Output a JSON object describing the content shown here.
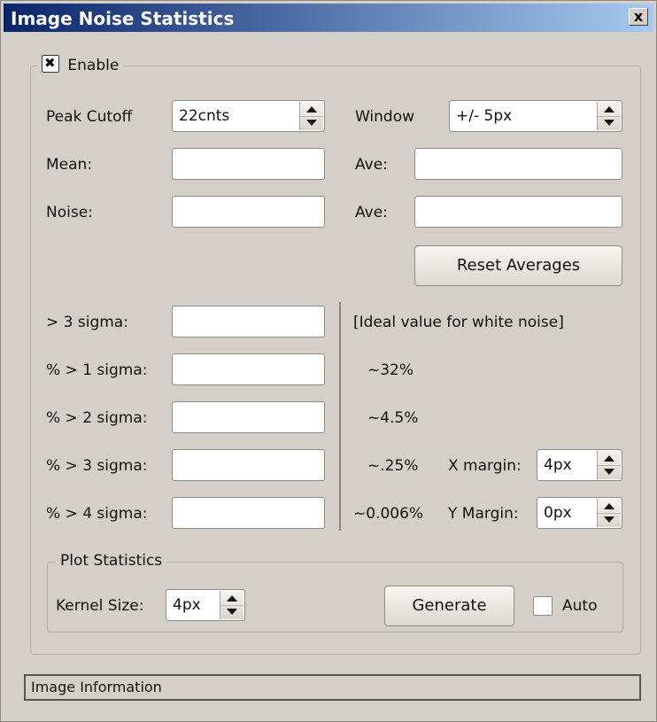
{
  "window": {
    "title": "Image Noise Statistics",
    "close_label": "x"
  },
  "enable": {
    "label": "Enable",
    "checked": true,
    "check_glyph": "✖"
  },
  "peak_cutoff": {
    "label": "Peak Cutoff",
    "value": "22cnts"
  },
  "window_size": {
    "label": "Window",
    "value": "+/- 5px"
  },
  "mean": {
    "label": "Mean:",
    "value": "",
    "ave_label": "Ave:",
    "ave_value": ""
  },
  "noise": {
    "label": "Noise:",
    "value": "",
    "ave_label": "Ave:",
    "ave_value": ""
  },
  "reset_averages_label": "Reset Averages",
  "sigma_rows": [
    {
      "label": "> 3 sigma:",
      "value": ""
    },
    {
      "label": "% > 1 sigma:",
      "value": ""
    },
    {
      "label": "% > 2 sigma:",
      "value": ""
    },
    {
      "label": "% > 3 sigma:",
      "value": ""
    },
    {
      "label": "% > 4 sigma:",
      "value": ""
    }
  ],
  "ideal": {
    "header": "[Ideal value for white noise]",
    "values": [
      "~32%",
      "~4.5%",
      "~.25%",
      "~0.006%"
    ]
  },
  "x_margin": {
    "label": "X margin:",
    "value": "4px"
  },
  "y_margin": {
    "label": "Y Margin:",
    "value": "0px"
  },
  "plot_statistics": {
    "title": "Plot Statistics",
    "kernel_label": "Kernel Size:",
    "kernel_value": "4px",
    "generate_label": "Generate",
    "auto_label": "Auto",
    "auto_checked": false
  },
  "status_bar": {
    "text": "Image Information"
  },
  "colors": {
    "title_bar_start": "#0a246a",
    "title_bar_end": "#a6caf0",
    "window_bg": "#d4d0c8"
  }
}
